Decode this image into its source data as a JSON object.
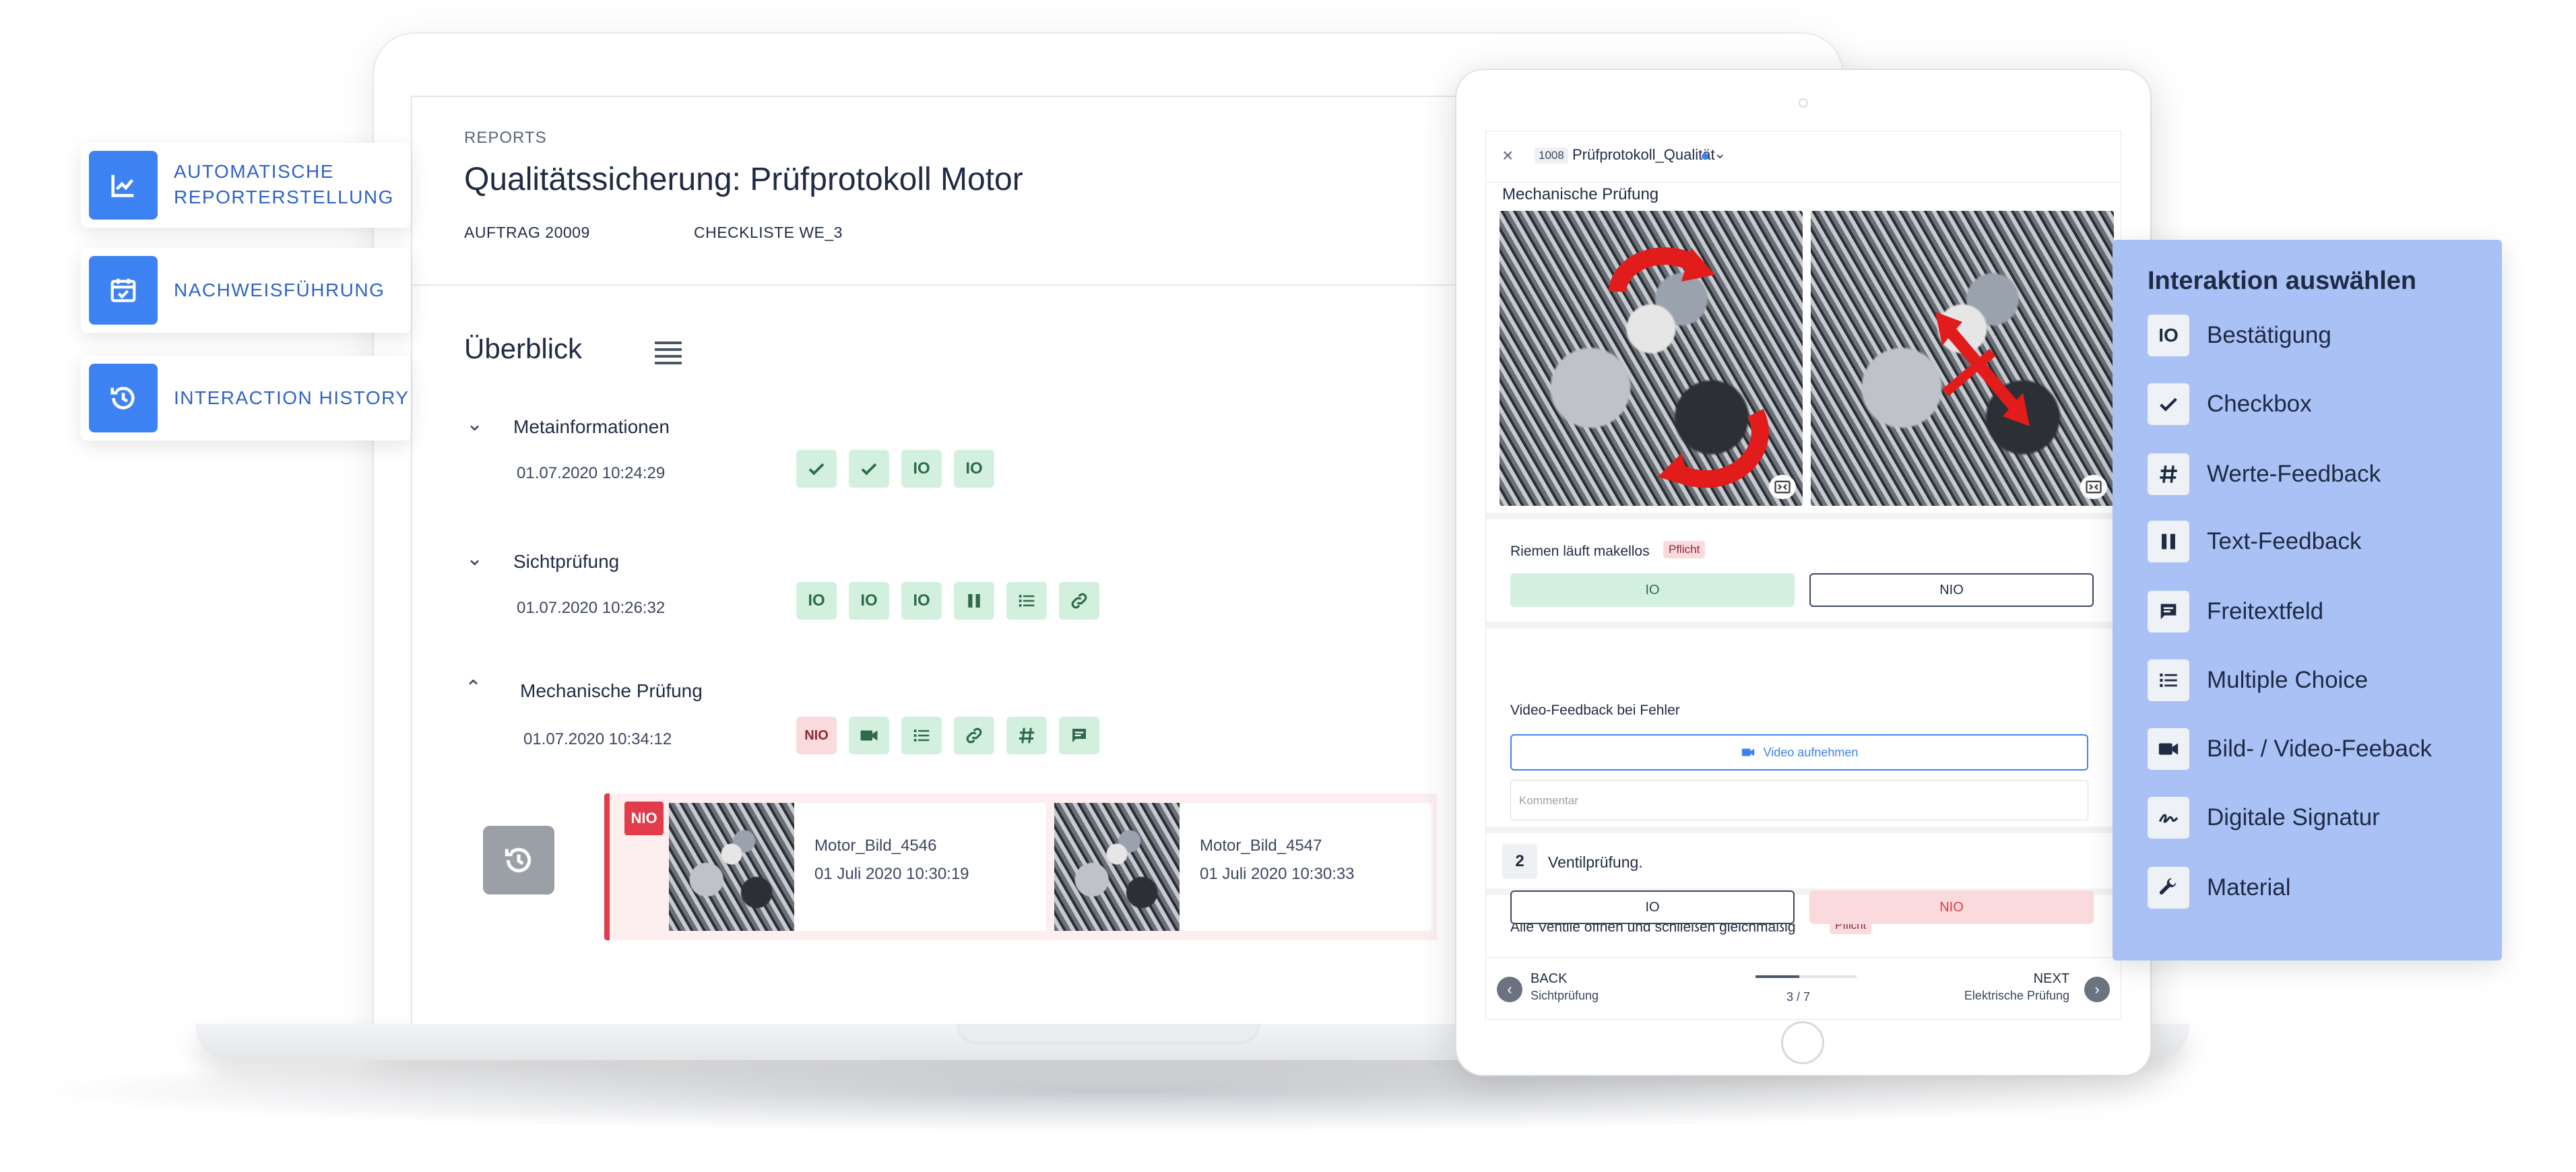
{
  "features": [
    {
      "line1": "AUTOMATISCHE",
      "line2": "REPORTERSTELLUNG",
      "icon": "chart-line-icon"
    },
    {
      "line1": "NACHWEISFÜHRUNG",
      "line2": "",
      "icon": "calendar-check-icon"
    },
    {
      "line1": "INTERACTION HISTORY",
      "line2": "",
      "icon": "history-icon"
    }
  ],
  "report": {
    "eyebrow": "REPORTS",
    "title": "Qualitätssicherung: Prüfprotokoll Motor",
    "auftrag": "AUFTRAG 20009",
    "checkliste": "CHECKLISTE WE_3",
    "overview": "Überblick",
    "sections": [
      {
        "title": "Metainformationen",
        "time": "01.07.2020 10:24:29",
        "chips": [
          "check",
          "check",
          "IO",
          "IO"
        ]
      },
      {
        "title": "Sichtprüfung",
        "time": "01.07.2020 10:26:32",
        "chips": [
          "IO",
          "IO",
          "IO",
          "text",
          "list",
          "link"
        ]
      },
      {
        "title": "Mechanische Prüfung",
        "time": "01.07.2020 10:34:12",
        "chips": [
          "NIO",
          "video",
          "list",
          "link",
          "hash",
          "comment"
        ]
      }
    ],
    "nio_badge": "NIO",
    "images": [
      {
        "name": "Motor_Bild_4546",
        "date": "01 Juli 2020 10:30:19"
      },
      {
        "name": "Motor_Bild_4547",
        "date": "01 Juli 2020 10:30:33"
      }
    ]
  },
  "tablet": {
    "close": "×",
    "protocol_id": "1008",
    "protocol_name": "Prüfprotokoll_Qualität",
    "section": "Mechanische Prüfung",
    "q1": {
      "label": "Riemen läuft makellos",
      "tag": "Pflicht",
      "io": "IO",
      "nio": "NIO"
    },
    "video": {
      "label": "Video-Feedback bei Fehler",
      "button": "Video aufnehmen",
      "comment_placeholder": "Kommentar"
    },
    "step": {
      "number": "2",
      "title": "Ventilprüfung."
    },
    "q2": {
      "label": "Alle Ventile öffnen und schließen gleichmäßig",
      "tag": "Pflicht",
      "io": "IO",
      "nio": "NIO"
    },
    "nav": {
      "back": "BACK",
      "back_sub": "Sichtprüfung",
      "next": "NEXT",
      "next_sub": "Elektrische Prüfung",
      "progress": "3 / 7",
      "progress_fraction": 0.43
    }
  },
  "interactions": {
    "title": "Interaktion auswählen",
    "items": [
      {
        "label": "Bestätigung",
        "glyph": "IO"
      },
      {
        "label": "Checkbox",
        "glyph": "check-icon"
      },
      {
        "label": "Werte-Feedback",
        "glyph": "hash-icon"
      },
      {
        "label": "Text-Feedback",
        "glyph": "columns-icon"
      },
      {
        "label": "Freitextfeld",
        "glyph": "comment-icon"
      },
      {
        "label": "Multiple Choice",
        "glyph": "list-icon"
      },
      {
        "label": "Bild- / Video-Feeback",
        "glyph": "video-icon"
      },
      {
        "label": "Digitale Signatur",
        "glyph": "signature-icon"
      },
      {
        "label": "Material",
        "glyph": "wrench-icon"
      }
    ]
  },
  "colors": {
    "accent": "#3d82f2",
    "ok": "#d2f0dd",
    "error": "#e23b4a",
    "panel": "#a9c1f5"
  }
}
